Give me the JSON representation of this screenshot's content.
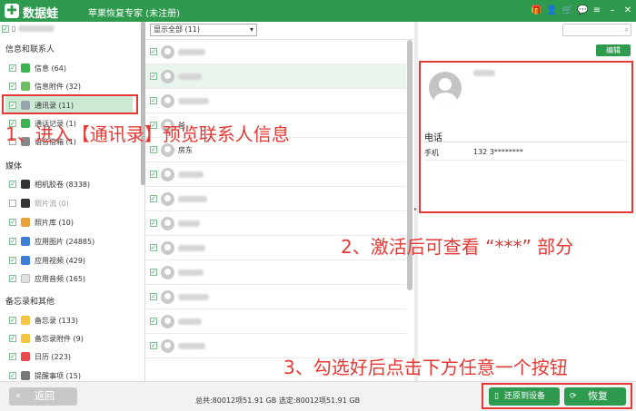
{
  "app": {
    "logo_text": "数据蛙",
    "title": "苹果恢复专家 (未注册)"
  },
  "titlebar_icons": [
    "gift-icon",
    "user-icon",
    "cart-icon",
    "chat-icon",
    "menu-icon",
    "minimize-icon",
    "close-icon"
  ],
  "sidebar": {
    "sections": {
      "info": "信息和联系人",
      "media": "媒体",
      "memo": "备忘录和其他"
    },
    "items": [
      {
        "label": "信息 (64)",
        "color": "#3cb34f",
        "icon": "message-icon"
      },
      {
        "label": "信息附件 (32)",
        "color": "#6fbf5f",
        "icon": "attachment-icon"
      },
      {
        "label": "通讯录 (11)",
        "color": "#9aa4b0",
        "icon": "contacts-icon"
      },
      {
        "label": "通话记录 (1)",
        "color": "#3cb34f",
        "icon": "phone-icon"
      },
      {
        "label": "语音信箱 (1)",
        "color": "#888",
        "icon": "voicemail-icon"
      },
      {
        "label": "相机胶卷 (8338)",
        "color": "#333",
        "icon": "camera-icon"
      },
      {
        "label": "照片流 (0)",
        "color": "#333",
        "icon": "photostream-icon"
      },
      {
        "label": "照片库 (10)",
        "color": "#e8a23a",
        "icon": "photo-library-icon"
      },
      {
        "label": "应用图片 (24885)",
        "color": "#3d7fd6",
        "icon": "app-photo-icon"
      },
      {
        "label": "应用视频 (429)",
        "color": "#3d7fd6",
        "icon": "app-video-icon"
      },
      {
        "label": "应用音频 (165)",
        "color": "#e0e0e0",
        "icon": "app-audio-icon"
      },
      {
        "label": "备忘录 (133)",
        "color": "#f5c542",
        "icon": "notes-icon"
      },
      {
        "label": "备忘录附件 (9)",
        "color": "#f5c542",
        "icon": "notes-attachment-icon"
      },
      {
        "label": "日历 (223)",
        "color": "#e84a4a",
        "icon": "calendar-icon"
      },
      {
        "label": "提醒事项 (15)",
        "color": "#777",
        "icon": "reminder-icon"
      }
    ]
  },
  "list": {
    "filter": "显示全部 (11)",
    "rows": [
      {
        "name": ""
      },
      {
        "name": ""
      },
      {
        "name": ""
      },
      {
        "name": "爸"
      },
      {
        "name": "房东"
      },
      {
        "name": ""
      },
      {
        "name": ""
      },
      {
        "name": ""
      },
      {
        "name": ""
      },
      {
        "name": ""
      },
      {
        "name": ""
      },
      {
        "name": ""
      },
      {
        "name": ""
      }
    ]
  },
  "detail": {
    "edit": "编辑",
    "section": "电话",
    "phone_label": "手机",
    "phone_value": "132 3********"
  },
  "bottom": {
    "back": "返回",
    "summary": "总共:80012项51.91 GB 选定:80012项51.91 GB",
    "restore_device": "还原到设备",
    "recover": "恢复"
  },
  "annotations": {
    "step1": "1、进入【通讯录】预览联系人信息",
    "step2": "2、激活后可查看 “***” 部分",
    "step3": "3、勾选好后点击下方任意一个按钮"
  },
  "colors": {
    "brand": "#2d9a4e",
    "annotation": "#e53935",
    "active": "#cce9d4"
  }
}
